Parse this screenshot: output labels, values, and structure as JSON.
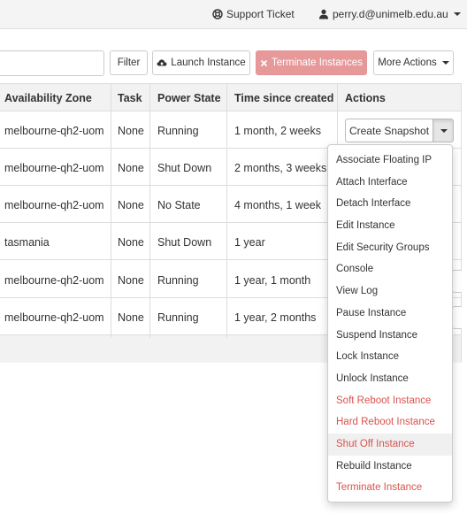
{
  "topbar": {
    "support_label": "Support Ticket",
    "user_label": "perry.d@unimelb.edu.au"
  },
  "toolbar": {
    "search_value": "",
    "filter_label": "Filter",
    "launch_label": "Launch Instance",
    "terminate_label": "Terminate Instances",
    "more_label": "More Actions"
  },
  "table": {
    "headers": {
      "az": "Availability Zone",
      "task": "Task",
      "power": "Power State",
      "time": "Time since created",
      "actions": "Actions"
    },
    "rows": [
      {
        "az": "melbourne-qh2-uom",
        "task": "None",
        "power": "Running",
        "time": "1 month, 2 weeks"
      },
      {
        "az": "melbourne-qh2-uom",
        "task": "None",
        "power": "Shut Down",
        "time": "2 months, 3 weeks"
      },
      {
        "az": "melbourne-qh2-uom",
        "task": "None",
        "power": "No State",
        "time": "4 months, 1 week"
      },
      {
        "az": "tasmania",
        "task": "None",
        "power": "Shut Down",
        "time": "1 year"
      },
      {
        "az": "melbourne-qh2-uom",
        "task": "None",
        "power": "Running",
        "time": "1 year, 1 month"
      },
      {
        "az": "melbourne-qh2-uom",
        "task": "None",
        "power": "Running",
        "time": "1 year, 2 months"
      }
    ]
  },
  "actions": {
    "primary_label": "Create Snapshot",
    "menu": [
      {
        "label": "Associate Floating IP",
        "style": "normal"
      },
      {
        "label": "Attach Interface",
        "style": "normal"
      },
      {
        "label": "Detach Interface",
        "style": "normal"
      },
      {
        "label": "Edit Instance",
        "style": "normal"
      },
      {
        "label": "Edit Security Groups",
        "style": "normal"
      },
      {
        "label": "Console",
        "style": "normal"
      },
      {
        "label": "View Log",
        "style": "normal"
      },
      {
        "label": "Pause Instance",
        "style": "normal"
      },
      {
        "label": "Suspend Instance",
        "style": "normal"
      },
      {
        "label": "Lock Instance",
        "style": "normal"
      },
      {
        "label": "Unlock Instance",
        "style": "normal"
      },
      {
        "label": "Soft Reboot Instance",
        "style": "danger"
      },
      {
        "label": "Hard Reboot Instance",
        "style": "danger"
      },
      {
        "label": "Shut Off Instance",
        "style": "danger-active"
      },
      {
        "label": "Rebuild Instance",
        "style": "normal"
      },
      {
        "label": "Terminate Instance",
        "style": "danger"
      }
    ]
  },
  "colors": {
    "danger": "#d9534f",
    "terminate_button_bg": "#e7999a",
    "header_bg": "#f2f2f2"
  },
  "icons": {
    "support": "life-ring-icon",
    "user": "user-icon",
    "launch": "cloud-upload-icon",
    "terminate": "times-icon"
  }
}
